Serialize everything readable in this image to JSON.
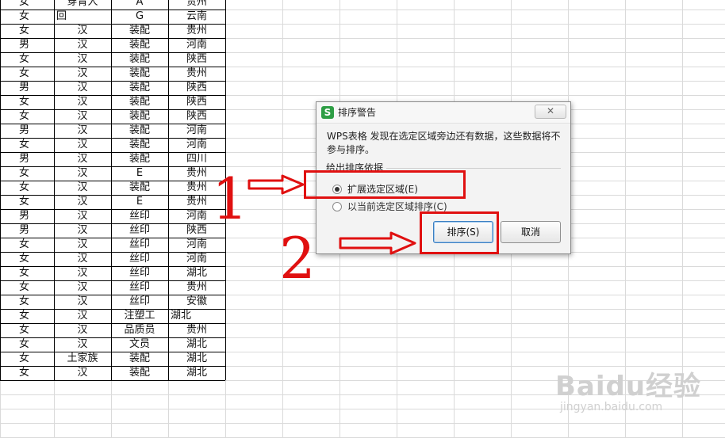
{
  "sheet": {
    "rows": [
      [
        "女",
        "穿青人",
        "A",
        "贵州"
      ],
      [
        "女",
        "回",
        "G",
        "云南"
      ],
      [
        "女",
        "汉",
        "装配",
        "贵州"
      ],
      [
        "男",
        "汉",
        "装配",
        "河南"
      ],
      [
        "女",
        "汉",
        "装配",
        "陕西"
      ],
      [
        "女",
        "汉",
        "装配",
        "贵州"
      ],
      [
        "男",
        "汉",
        "装配",
        "陕西"
      ],
      [
        "女",
        "汉",
        "装配",
        "陕西"
      ],
      [
        "女",
        "汉",
        "装配",
        "陕西"
      ],
      [
        "男",
        "汉",
        "装配",
        "河南"
      ],
      [
        "女",
        "汉",
        "装配",
        "河南"
      ],
      [
        "男",
        "汉",
        "装配",
        "四川"
      ],
      [
        "女",
        "汉",
        "E",
        "贵州"
      ],
      [
        "女",
        "汉",
        "装配",
        "贵州"
      ],
      [
        "女",
        "汉",
        "E",
        "贵州"
      ],
      [
        "男",
        "汉",
        "丝印",
        "河南"
      ],
      [
        "男",
        "汉",
        "丝印",
        "陕西"
      ],
      [
        "女",
        "汉",
        "丝印",
        "河南"
      ],
      [
        "女",
        "汉",
        "丝印",
        "河南"
      ],
      [
        "女",
        "汉",
        "丝印",
        "湖北"
      ],
      [
        "女",
        "汉",
        "丝印",
        "贵州"
      ],
      [
        "女",
        "汉",
        "丝印",
        "安徽"
      ],
      [
        "女",
        "汉",
        "注塑工",
        "湖北"
      ],
      [
        "女",
        "汉",
        "品质员",
        "贵州"
      ],
      [
        "女",
        "汉",
        "文员",
        "湖北"
      ],
      [
        "女",
        "土家族",
        "装配",
        "湖北"
      ],
      [
        "女",
        "汉",
        "装配",
        "湖北"
      ]
    ]
  },
  "dialog": {
    "app_icon": "S",
    "title": "排序警告",
    "close": "✕",
    "message": "WPS表格 发现在选定区域旁边还有数据，这些数据将不参与排序。",
    "group_label": "给出排序依据",
    "options": [
      {
        "label": "扩展选定区域(E)",
        "selected": true
      },
      {
        "label": "以当前选定区域排序(C)",
        "selected": false
      }
    ],
    "sort_button": "排序(S)",
    "cancel_button": "取消"
  },
  "annotations": {
    "step1": "1",
    "step2": "2",
    "color": "#e01010"
  },
  "watermark": {
    "brand": "Baidu经验",
    "url": "jingyan.baidu.com"
  }
}
